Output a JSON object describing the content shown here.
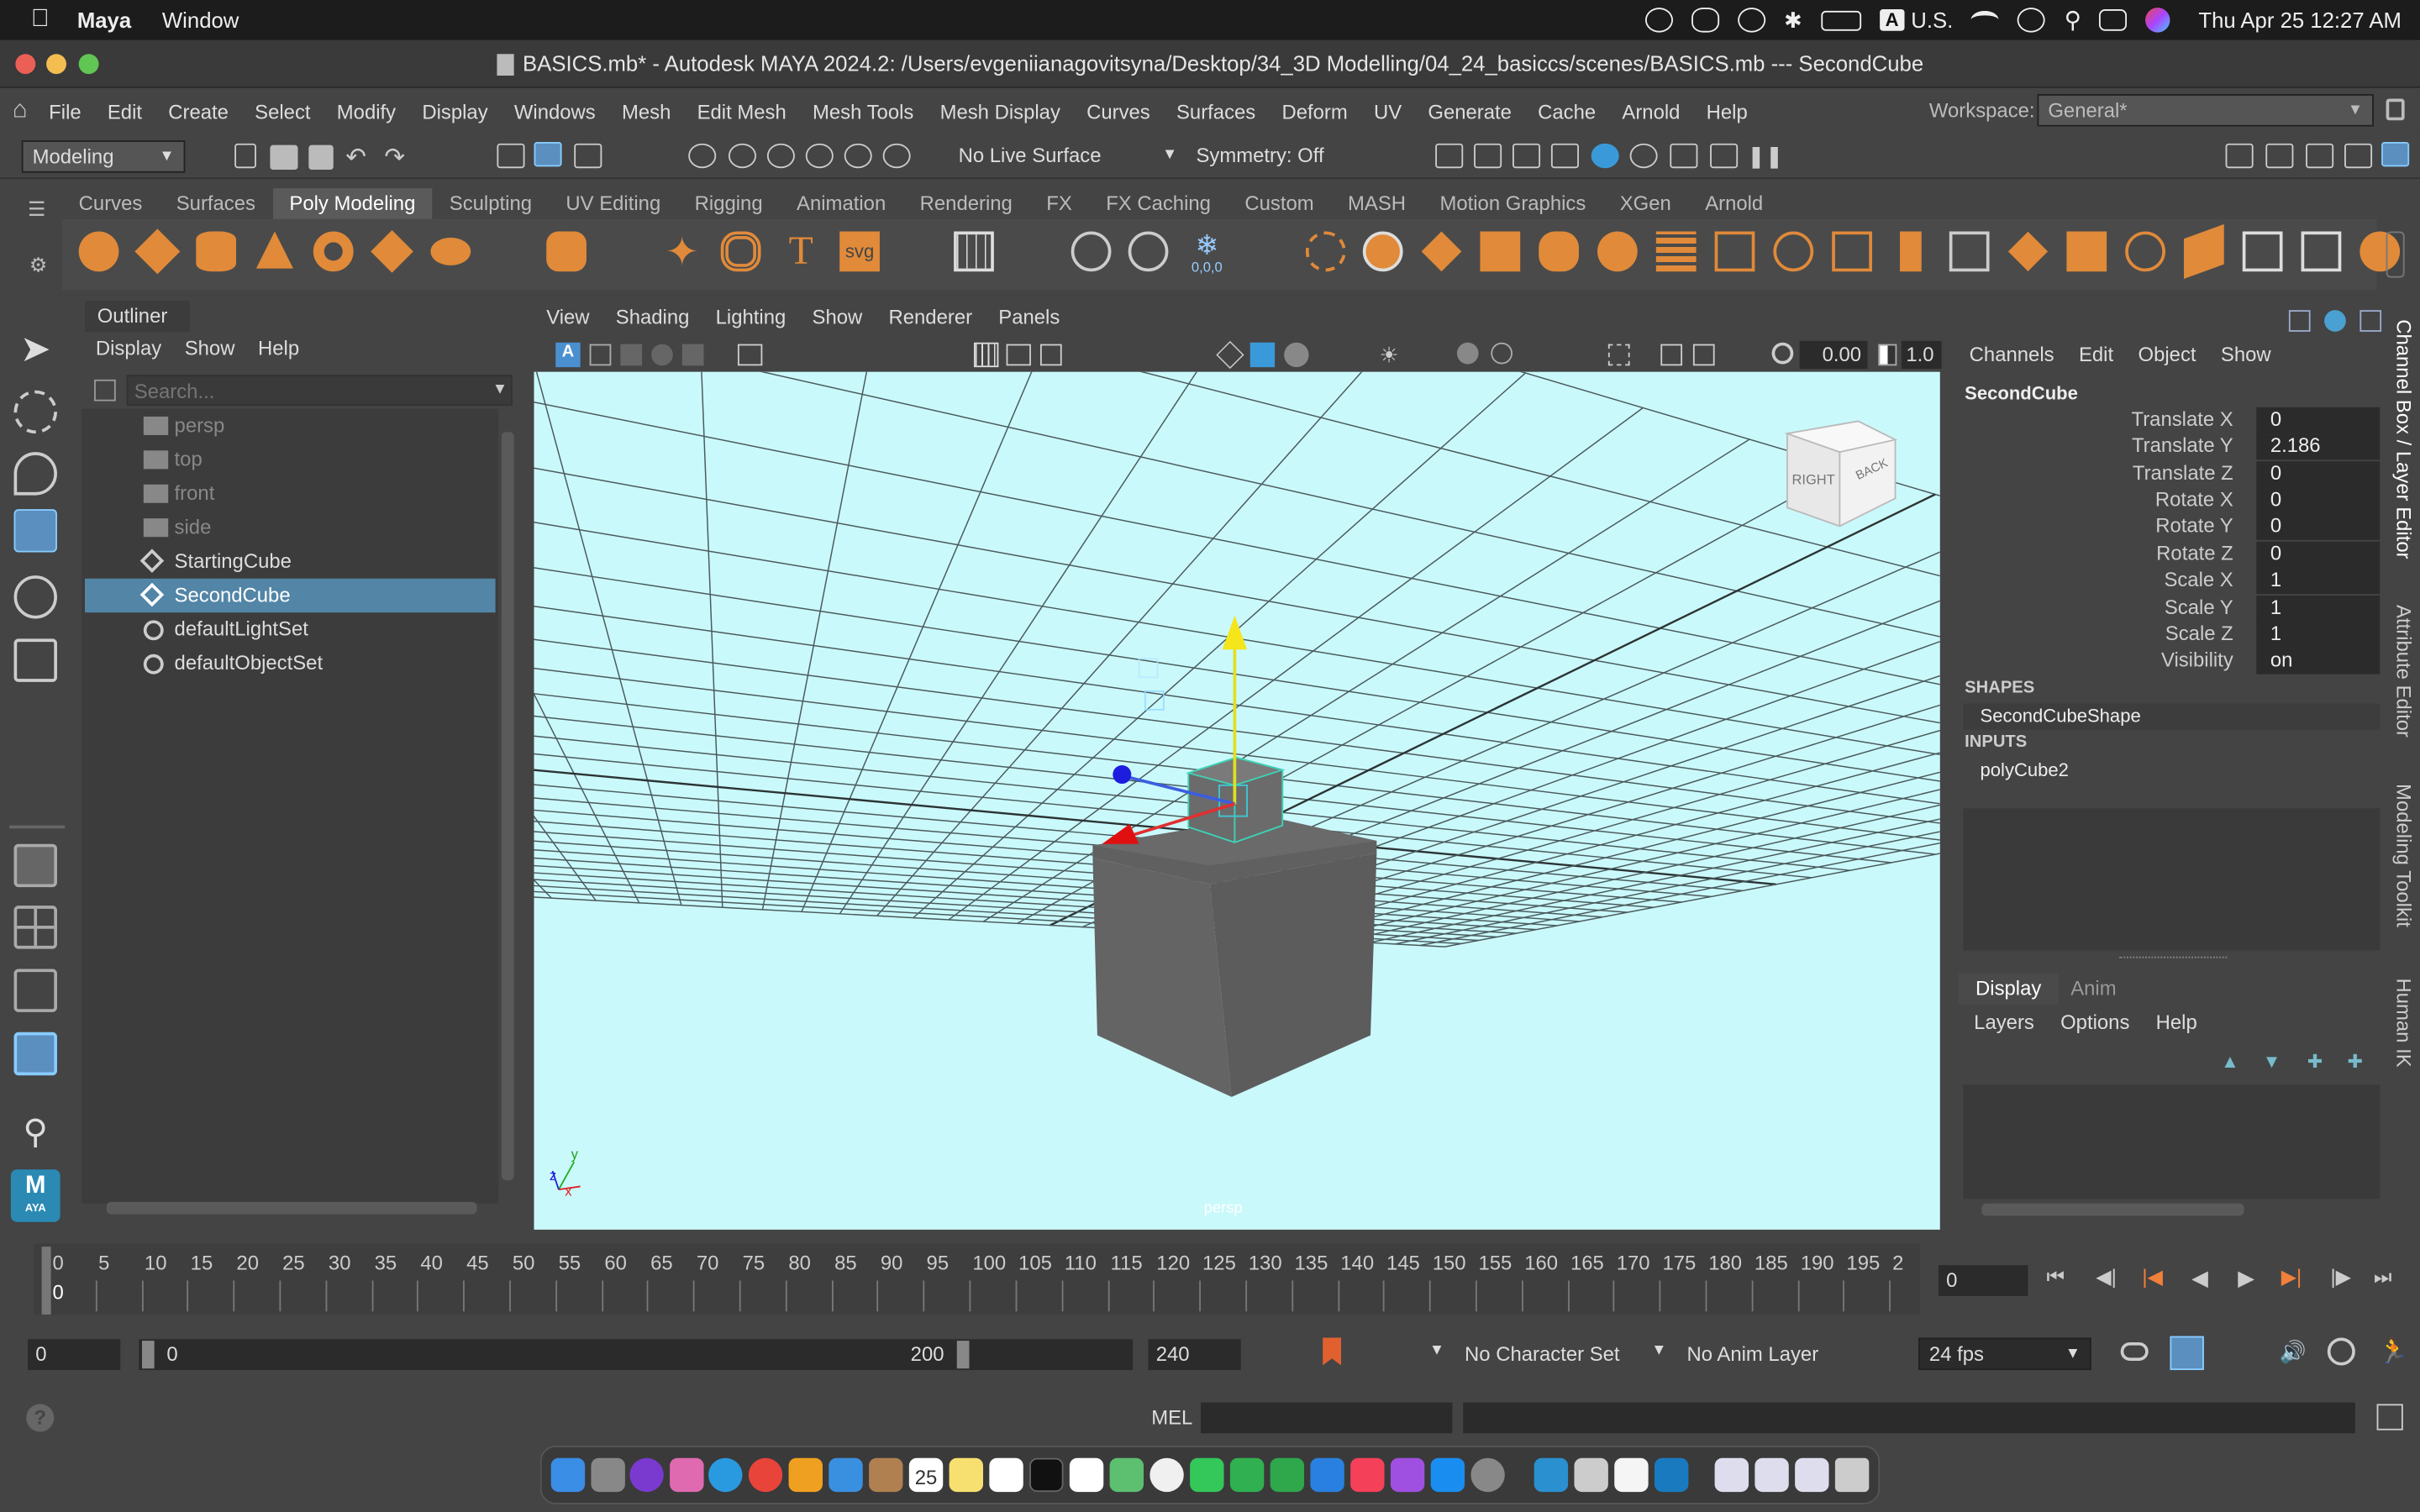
{
  "mac_menubar": {
    "app": "Maya",
    "items": [
      "Window"
    ],
    "input_source": "U.S.",
    "clock": "Thu Apr 25  12:27 AM"
  },
  "window": {
    "title": "BASICS.mb* - Autodesk MAYA 2024.2: /Users/evgeniianagovitsyna/Desktop/34_3D Modelling/04_24_basiccs/scenes/BASICS.mb   ---   SecondCube"
  },
  "main_menu": [
    "File",
    "Edit",
    "Create",
    "Select",
    "Modify",
    "Display",
    "Windows",
    "Mesh",
    "Edit Mesh",
    "Mesh Tools",
    "Mesh Display",
    "Curves",
    "Surfaces",
    "Deform",
    "UV",
    "Generate",
    "Cache",
    "Arnold",
    "Help"
  ],
  "workspace": {
    "label": "Workspace:",
    "value": "General*"
  },
  "status_line": {
    "menu_set": "Modeling",
    "live_surface": "No Live Surface",
    "symmetry": "Symmetry: Off"
  },
  "shelf_tabs": [
    "Curves",
    "Surfaces",
    "Poly Modeling",
    "Sculpting",
    "UV Editing",
    "Rigging",
    "Animation",
    "Rendering",
    "FX",
    "FX Caching",
    "Custom",
    "MASH",
    "Motion Graphics",
    "XGen",
    "Arnold"
  ],
  "shelf_active_tab": "Poly Modeling",
  "shelf_text_icons": {
    "text": "T",
    "svg": "svg",
    "coords": "0,0,0"
  },
  "outliner": {
    "title": "Outliner",
    "menu": [
      "Display",
      "Show",
      "Help"
    ],
    "search_placeholder": "Search...",
    "items": [
      {
        "name": "persp",
        "type": "camera",
        "dim": true
      },
      {
        "name": "top",
        "type": "camera",
        "dim": true
      },
      {
        "name": "front",
        "type": "camera",
        "dim": true
      },
      {
        "name": "side",
        "type": "camera",
        "dim": true
      },
      {
        "name": "StartingCube",
        "type": "mesh",
        "dim": false
      },
      {
        "name": "SecondCube",
        "type": "mesh",
        "dim": false,
        "selected": true
      },
      {
        "name": "defaultLightSet",
        "type": "set",
        "dim": false
      },
      {
        "name": "defaultObjectSet",
        "type": "set",
        "dim": false
      }
    ]
  },
  "viewport": {
    "menu": [
      "View",
      "Shading",
      "Lighting",
      "Show",
      "Renderer",
      "Panels"
    ],
    "field1": "0.00",
    "field2": "1.0",
    "camera_label": "persp",
    "view_cube": {
      "right": "RIGHT",
      "back": "BACK"
    },
    "axis": {
      "x": "x",
      "y": "y",
      "z": "z"
    },
    "background_color": "#caf9fb"
  },
  "channel_box": {
    "menu": [
      "Channels",
      "Edit",
      "Object",
      "Show"
    ],
    "object": "SecondCube",
    "channels": [
      {
        "label": "Translate X",
        "value": "0"
      },
      {
        "label": "Translate Y",
        "value": "2.186"
      },
      {
        "label": "Translate Z",
        "value": "0"
      },
      {
        "label": "Rotate X",
        "value": "0"
      },
      {
        "label": "Rotate Y",
        "value": "0"
      },
      {
        "label": "Rotate Z",
        "value": "0"
      },
      {
        "label": "Scale X",
        "value": "1"
      },
      {
        "label": "Scale Y",
        "value": "1"
      },
      {
        "label": "Scale Z",
        "value": "1"
      },
      {
        "label": "Visibility",
        "value": "on"
      }
    ],
    "shapes_header": "SHAPES",
    "shape": "SecondCubeShape",
    "inputs_header": "INPUTS",
    "input": "polyCube2"
  },
  "layer_editor": {
    "tabs": [
      "Display",
      "Anim"
    ],
    "menu": [
      "Layers",
      "Options",
      "Help"
    ]
  },
  "side_tabs": [
    "Channel Box / Layer Editor",
    "Attribute Editor",
    "Modeling Toolkit",
    "Human IK"
  ],
  "timeline": {
    "ticks": [
      "0",
      "5",
      "10",
      "15",
      "20",
      "25",
      "30",
      "35",
      "40",
      "45",
      "50",
      "55",
      "60",
      "65",
      "70",
      "75",
      "80",
      "85",
      "90",
      "95",
      "100",
      "105",
      "110",
      "115",
      "120",
      "125",
      "130",
      "135",
      "140",
      "145",
      "150",
      "155",
      "160",
      "165",
      "170",
      "175",
      "180",
      "185",
      "190",
      "195",
      "2"
    ],
    "current_marker": "0",
    "current_frame": "0"
  },
  "range": {
    "start": "0",
    "range_start": "0",
    "range_end": "200",
    "end": "240",
    "character_set": "No Character Set",
    "anim_layer": "No Anim Layer",
    "fps": "24 fps"
  },
  "command_line": {
    "label": "MEL"
  },
  "toolbox_logo": {
    "letter": "M",
    "sub": "AYA"
  },
  "dock": {
    "calendar_day": "25"
  }
}
